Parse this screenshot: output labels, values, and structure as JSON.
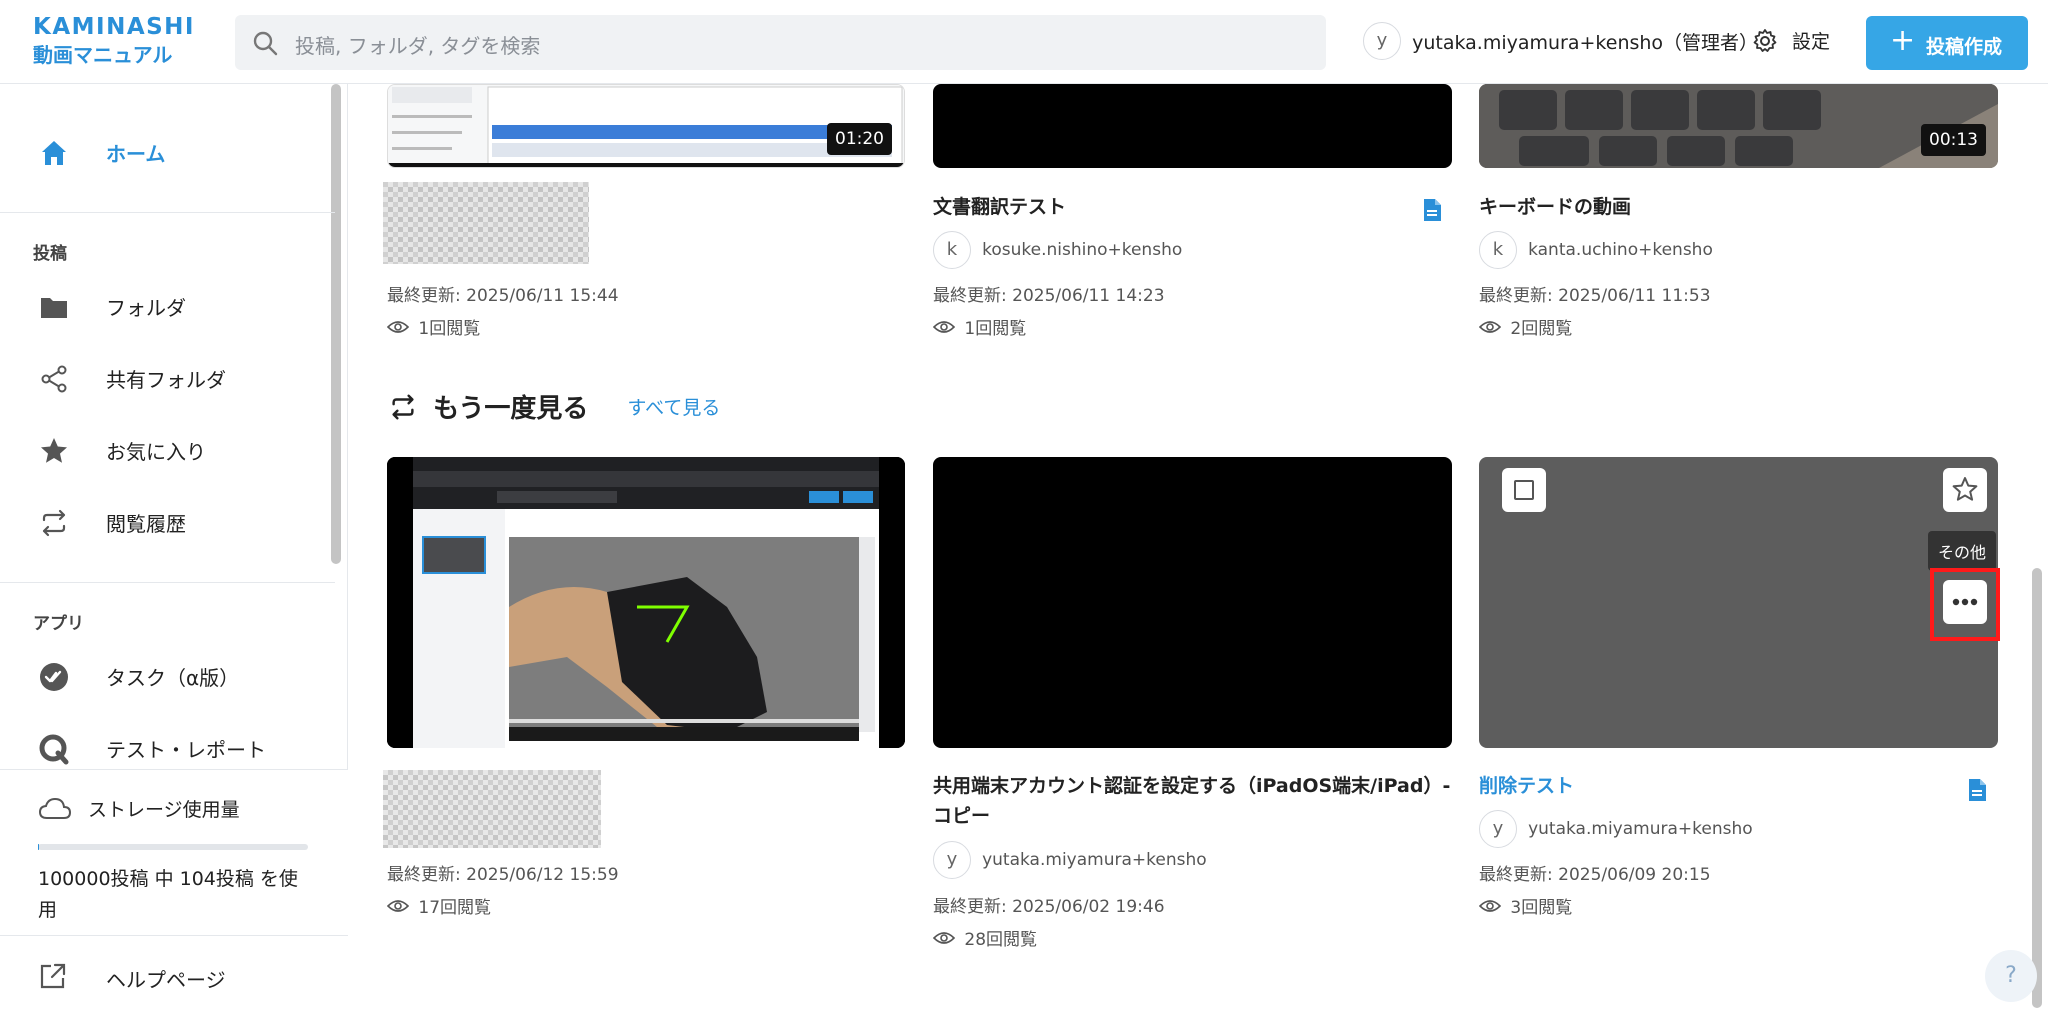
{
  "header": {
    "logo_line1": "KAMINASHI",
    "logo_line2": "動画マニュアル",
    "search_placeholder": "投稿, フォルダ, タグを検索",
    "user_avatar": "y",
    "user_name": "yutaka.miyamura+kensho（管理者）",
    "settings_label": "設定",
    "post_button_label": "投稿作成"
  },
  "sidebar": {
    "home_label": "ホーム",
    "posts_section": "投稿",
    "items": [
      {
        "label": "フォルダ",
        "icon": "folder-icon"
      },
      {
        "label": "共有フォルダ",
        "icon": "share-icon"
      },
      {
        "label": "お気に入り",
        "icon": "star-icon"
      },
      {
        "label": "閲覧履歴",
        "icon": "history-icon"
      }
    ],
    "apps_section": "アプリ",
    "apps": [
      {
        "label": "タスク（α版）",
        "icon": "task-icon"
      },
      {
        "label": "テスト・レポート",
        "icon": "test-report-icon"
      }
    ],
    "storage_title": "ストレージ使用量",
    "storage_fraction": 0.00104,
    "storage_usage": "100000投稿 中 104投稿 を使用",
    "help_label": "ヘルプページ"
  },
  "top_row": [
    {
      "duration": "01:20",
      "updated": "最終更新: 2025/06/11 15:44",
      "views": "1回閲覧"
    },
    {
      "title": "文書翻訳テスト",
      "author_avatar": "k",
      "author": "kosuke.nishino+kensho",
      "updated": "最終更新: 2025/06/11 14:23",
      "views": "1回閲覧"
    },
    {
      "title": "キーボードの動画",
      "duration": "00:13",
      "author_avatar": "k",
      "author": "kanta.uchino+kensho",
      "updated": "最終更新: 2025/06/11 11:53",
      "views": "2回閲覧"
    }
  ],
  "rewatch": {
    "title": "もう一度見る",
    "see_all": "すべて見る",
    "cards": [
      {
        "updated": "最終更新: 2025/06/12 15:59",
        "views": "17回閲覧"
      },
      {
        "title_line1": "共用端末アカウント認証を設定する（iPadOS端末/iPad）-",
        "title_line2": "コピー",
        "author_avatar": "y",
        "author": "yutaka.miyamura+kensho",
        "updated": "最終更新: 2025/06/02 19:46",
        "views": "28回閲覧"
      },
      {
        "title": "削除テスト",
        "author_avatar": "y",
        "author": "yutaka.miyamura+kensho",
        "updated": "最終更新: 2025/06/09 20:15",
        "views": "3回閲覧",
        "tooltip": "その他"
      }
    ]
  },
  "help_fab": "?"
}
